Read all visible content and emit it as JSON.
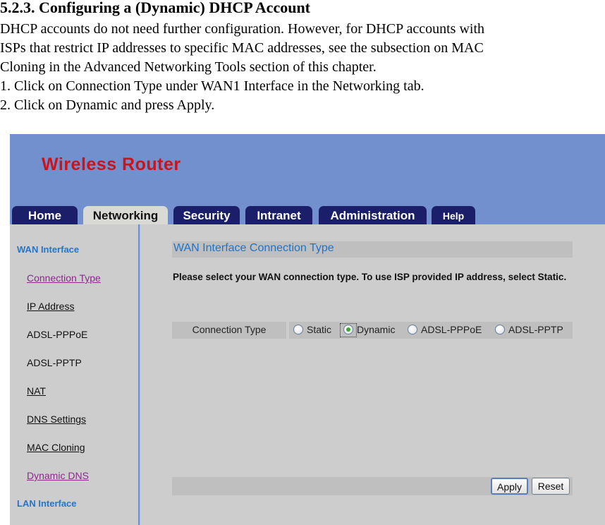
{
  "document": {
    "heading": "5.2.3. Configuring a (Dynamic) DHCP Account",
    "paragraph_lines": [
      "DHCP accounts do not need further configuration. However, for DHCP accounts with",
      "ISPs that restrict IP addresses to specific MAC addresses, see the subsection on MAC",
      "Cloning in the Advanced Networking Tools section of this chapter."
    ],
    "steps": [
      "1. Click on Connection Type under WAN1 Interface in the Networking tab.",
      "2. Click on Dynamic and press Apply."
    ]
  },
  "router_ui": {
    "brand": "Wireless Router",
    "colors": {
      "banner": "#7290cd",
      "brand_text": "#c8141a",
      "tab_bg": "#1b1f69",
      "accent_blue": "#2575c8"
    },
    "tabs": [
      {
        "label": "Home",
        "active": false
      },
      {
        "label": "Networking",
        "active": true
      },
      {
        "label": "Security",
        "active": false
      },
      {
        "label": "Intranet",
        "active": false
      },
      {
        "label": "Administration",
        "active": false
      },
      {
        "label": "Help",
        "active": false
      }
    ],
    "sidebar": {
      "section_wan": "WAN Interface",
      "items": [
        {
          "label": "Connection Type"
        },
        {
          "label": "IP Address"
        },
        {
          "label": "ADSL-PPPoE"
        },
        {
          "label": "ADSL-PPTP"
        },
        {
          "label": "NAT"
        },
        {
          "label": "DNS Settings"
        },
        {
          "label": "MAC Cloning"
        },
        {
          "label": "Dynamic DNS"
        }
      ],
      "section_lan": "LAN Interface"
    },
    "main": {
      "title": "WAN Interface Connection Type",
      "instruction": "Please select your WAN connection type. To use ISP provided IP address, select Static.",
      "field_label": "Connection Type",
      "options": [
        {
          "label": "Static",
          "checked": false
        },
        {
          "label": "Dynamic",
          "checked": true
        },
        {
          "label": "ADSL-PPPoE",
          "checked": false
        },
        {
          "label": "ADSL-PPTP",
          "checked": false
        }
      ],
      "apply_label": "Apply",
      "reset_label": "Reset"
    }
  }
}
